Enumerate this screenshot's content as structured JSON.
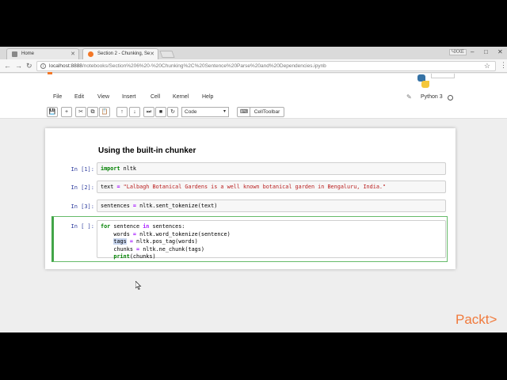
{
  "browser": {
    "tabs": [
      {
        "label": "Home",
        "active": false
      },
      {
        "label": "Section 2 - Chunking, Se",
        "active": true
      }
    ],
    "user_badge": "ЧХХЕ",
    "window_controls": [
      "–",
      "□",
      "✕"
    ],
    "url_host": "localhost:8888",
    "url_path": "/notebooks/Section%206%20-%20Chunking%2C%20Sentence%20Parse%20and%20Dependencies.ipynb"
  },
  "jupyter": {
    "menu": [
      "File",
      "Edit",
      "View",
      "Insert",
      "Cell",
      "Kernel",
      "Help"
    ],
    "kernel_name": "Python 3",
    "toolbar": {
      "buttons": [
        "💾",
        "+",
        "✂",
        "⧉",
        "📋",
        "↑",
        "↓",
        "⏭",
        "■",
        "↻"
      ],
      "cell_type": "Code",
      "keyboard_icon": "⌨",
      "celltoolbar": "CellToolbar"
    }
  },
  "notebook": {
    "heading": "Using the built-in chunker",
    "cells": [
      {
        "prompt": "In [1]:"
      },
      {
        "prompt": "In [2]:"
      },
      {
        "prompt": "In [3]:"
      },
      {
        "prompt": "In [ ]:"
      }
    ],
    "code": {
      "c1_kw": "import",
      "c1_rest": " nltk",
      "c2_a": "text ",
      "c2_eq": "=",
      "c2_str": " \"Lalbagh Botanical Gardens is a well known botanical garden in Bengaluru, India.\"",
      "c3_a": "sentences ",
      "c3_eq": "=",
      "c3_b": " nltk.sent_tokenize(text)",
      "c4_l1_kw": "for",
      "c4_l1_a": " sentence ",
      "c4_l1_in": "in",
      "c4_l1_b": " sentences:",
      "c4_l2_a": "    words ",
      "c4_l2_eq": "=",
      "c4_l2_b": " nltk.word_tokenize(sentence)",
      "c4_l3_indent": "    ",
      "c4_l3_sel": "tags",
      "c4_l3_a": " ",
      "c4_l3_eq": "=",
      "c4_l3_b": " nltk.pos_tag(words)",
      "c4_l4_a": "    chunks ",
      "c4_l4_eq": "=",
      "c4_l4_b": " nltk.ne_chunk(tags)",
      "c4_l5_indent": "    ",
      "c4_l5_kw": "print",
      "c4_l5_b": "(chunks)"
    }
  },
  "brand": {
    "logo": "Packt>",
    "color": "#f07a3c"
  }
}
